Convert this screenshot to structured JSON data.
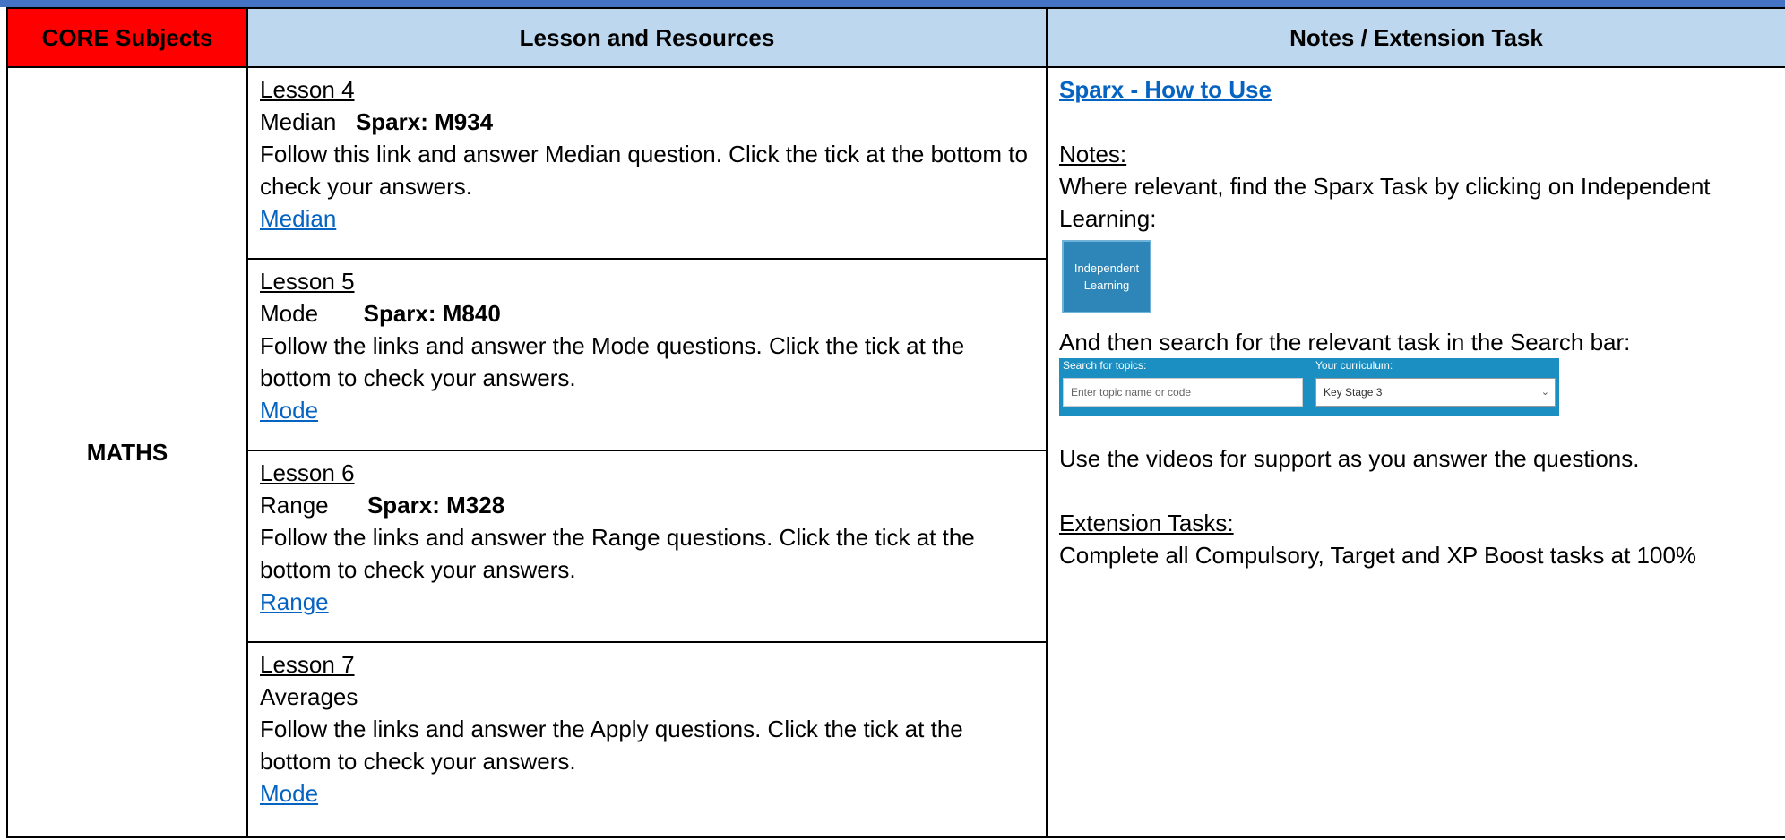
{
  "header": {
    "core": "CORE Subjects",
    "lesson": "Lesson and Resources",
    "notes": "Notes / Extension Task"
  },
  "subject": "MATHS",
  "lessons": [
    {
      "title": "Lesson 4",
      "topic": "Median",
      "sparx": "Sparx: M934",
      "instruction": "Follow this link and answer Median question. Click the tick at the bottom to check your answers.",
      "link": "Median"
    },
    {
      "title": "Lesson 5",
      "topic": "Mode",
      "sparx": "Sparx: M840",
      "instruction": "Follow the links and answer the Mode questions. Click the tick at the bottom to check your answers.",
      "link": "Mode"
    },
    {
      "title": "Lesson 6",
      "topic": "Range",
      "sparx": "Sparx: M328",
      "instruction": "Follow the links and answer the Range questions. Click the tick at the bottom to check your answers.",
      "link": "Range"
    },
    {
      "title": "Lesson 7",
      "topic": "Averages",
      "sparx": "",
      "instruction": "Follow the links and answer the Apply questions. Click the tick at the bottom to check your answers.",
      "link": "Mode"
    }
  ],
  "notes": {
    "howto_link": "Sparx - How to Use",
    "notes_heading": "Notes:",
    "notes_text": "Where relevant, find the Sparx Task by clicking on Independent Learning:",
    "il_button_line1": "Independent",
    "il_button_line2": "Learning",
    "search_text": "And then search for the relevant task in the Search bar:",
    "search_label": "Search for topics:",
    "curriculum_label": "Your curriculum:",
    "search_placeholder": "Enter topic name or code",
    "curriculum_value": "Key Stage 3",
    "videos_text": "Use the videos for support as you answer the questions.",
    "extension_heading": "Extension Tasks:",
    "extension_text": "Complete all Compulsory, Target and XP Boost tasks at 100%"
  }
}
